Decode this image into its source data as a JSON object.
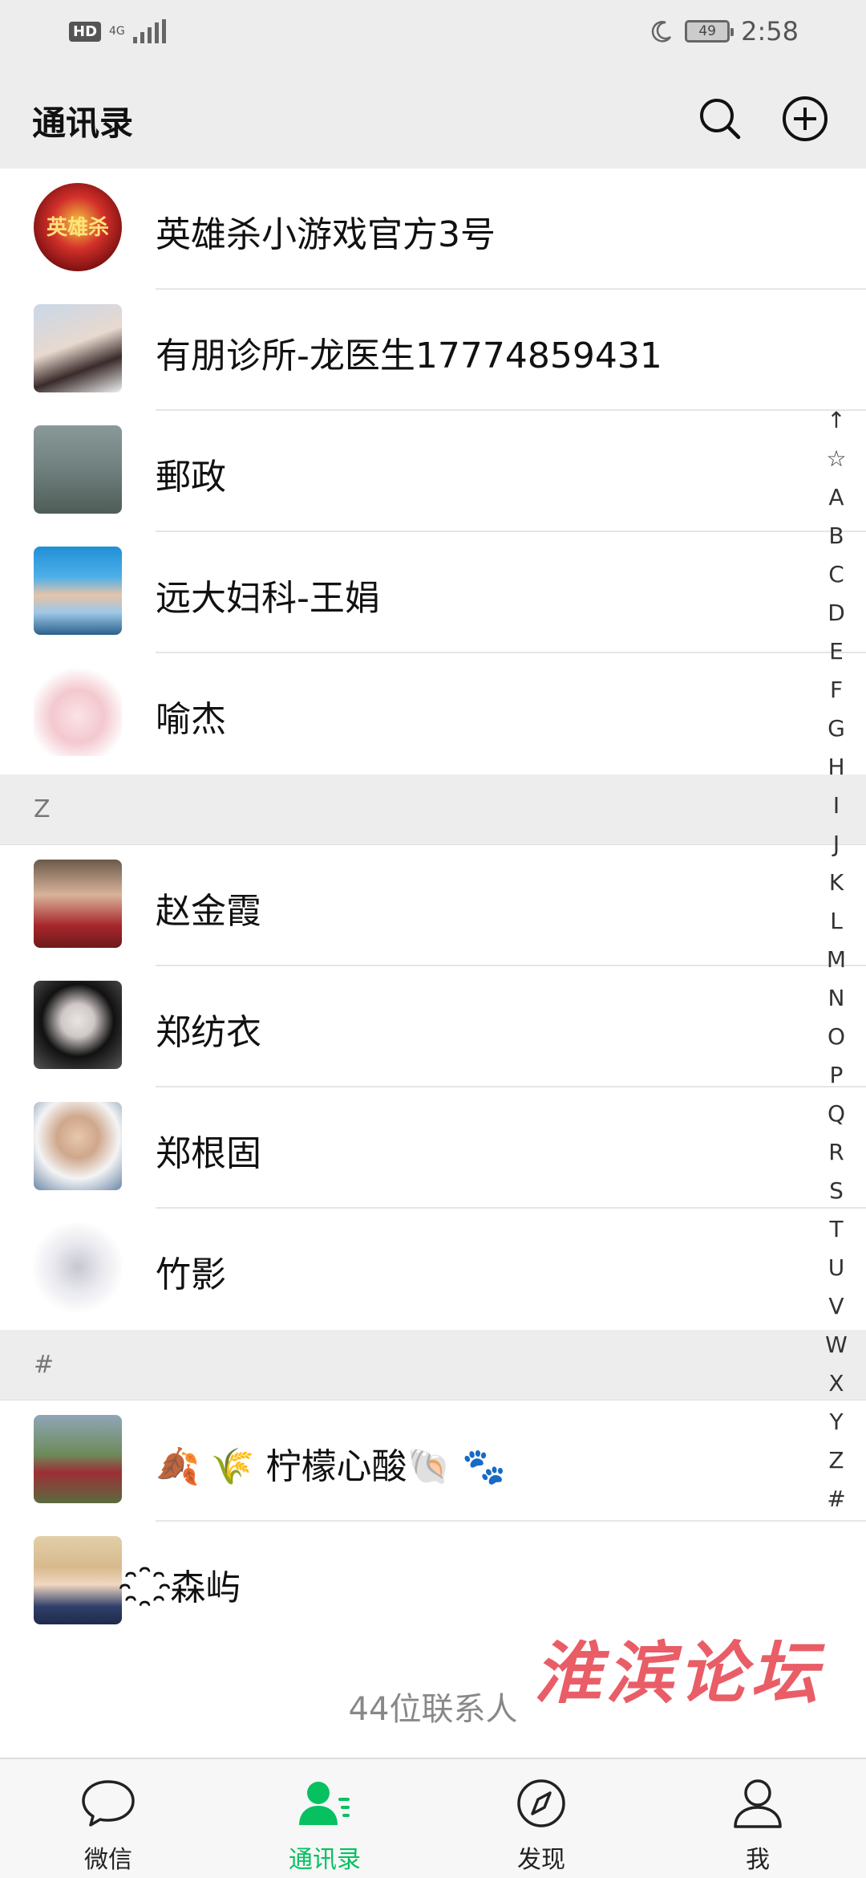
{
  "status_bar": {
    "hd": "HD",
    "network": "4G",
    "battery": "49",
    "time": "2:58"
  },
  "header": {
    "title": "通讯录",
    "search_icon": "search-icon",
    "add_icon": "add-circle-icon"
  },
  "contacts_top": [
    {
      "name": "英雄杀小游戏官方3号",
      "avatar": "game-logo"
    },
    {
      "name": "有朋诊所-龙医生17774859431",
      "avatar": "photo"
    },
    {
      "name": "郵政",
      "avatar": "photo"
    },
    {
      "name": "远大妇科-王娟",
      "avatar": "photo"
    },
    {
      "name": "喻杰",
      "avatar": "photo"
    }
  ],
  "section_z": {
    "letter": "Z"
  },
  "contacts_z": [
    {
      "name": "赵金霞",
      "avatar": "photo"
    },
    {
      "name": "郑纺衣",
      "avatar": "photo"
    },
    {
      "name": "郑根固",
      "avatar": "photo"
    },
    {
      "name": "竹影",
      "avatar": "photo"
    }
  ],
  "section_hash": {
    "letter": "#"
  },
  "contacts_hash": [
    {
      "name": "🍂 🌾 柠檬心酸🐚 🐾",
      "avatar": "photo"
    },
    {
      "name": "҈森屿",
      "avatar": "photo"
    }
  ],
  "contact_count": "44位联系人",
  "watermark": "淮滨论坛",
  "index_bar": [
    "↑",
    "☆",
    "A",
    "B",
    "C",
    "D",
    "E",
    "F",
    "G",
    "H",
    "I",
    "J",
    "K",
    "L",
    "M",
    "N",
    "O",
    "P",
    "Q",
    "R",
    "S",
    "T",
    "U",
    "V",
    "W",
    "X",
    "Y",
    "Z",
    "#"
  ],
  "tabs": [
    {
      "label": "微信",
      "icon": "chat-bubble-icon",
      "active": false
    },
    {
      "label": "通讯录",
      "icon": "contacts-icon",
      "active": true
    },
    {
      "label": "发现",
      "icon": "compass-icon",
      "active": false
    },
    {
      "label": "我",
      "icon": "person-icon",
      "active": false
    }
  ],
  "colors": {
    "accent": "#07c160",
    "watermark": "#e8505b",
    "background": "#ededed"
  }
}
